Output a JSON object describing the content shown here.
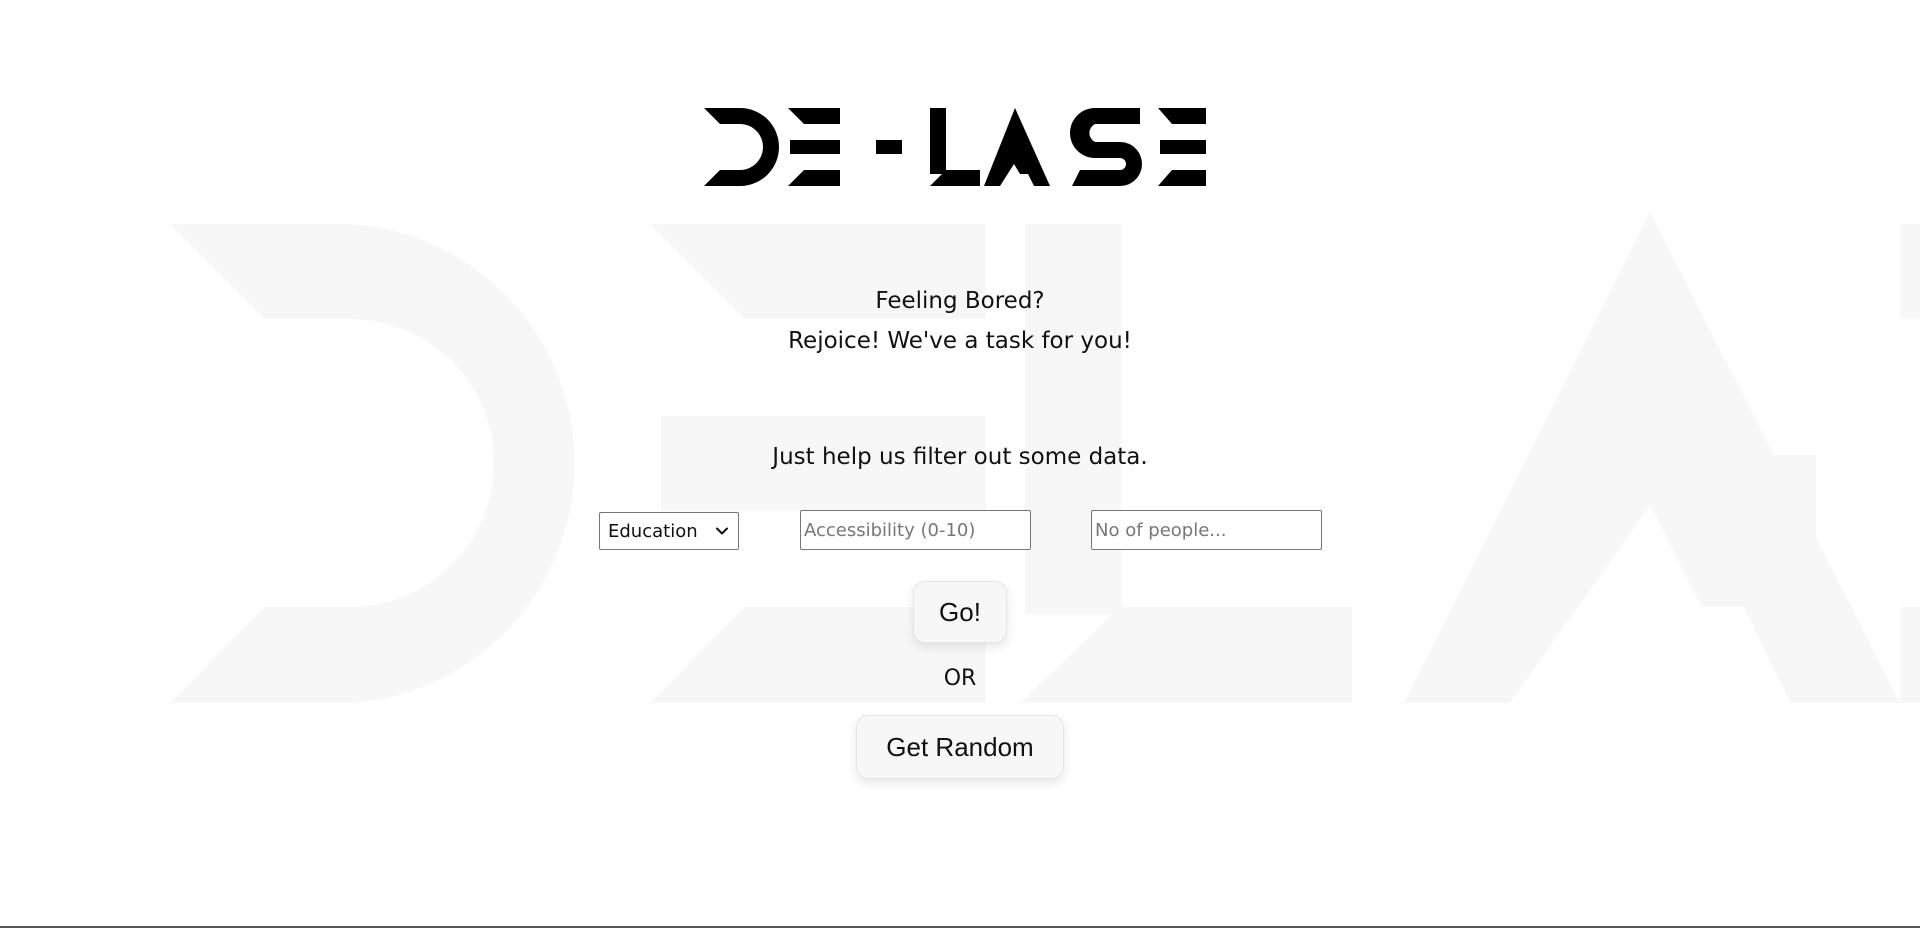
{
  "brand": {
    "logo_text": "DE-LASE",
    "watermark_text": "DE-LASE"
  },
  "intro": {
    "line1": "Feeling Bored?",
    "line2": "Rejoice! We've a task for you!",
    "line3": "Just help us filter out some data."
  },
  "filters": {
    "category": {
      "selected": "Education",
      "icon": "chevron-down-icon"
    },
    "accessibility": {
      "value": "",
      "placeholder": "Accessibility (0-10)"
    },
    "participants": {
      "value": "",
      "placeholder": "No of people..."
    }
  },
  "actions": {
    "go_label": "Go!",
    "or_label": "OR",
    "random_label": "Get Random"
  },
  "colors": {
    "logo": "#000000",
    "watermark": "#f7f7f7",
    "button_bg": "#f7f7f7"
  }
}
